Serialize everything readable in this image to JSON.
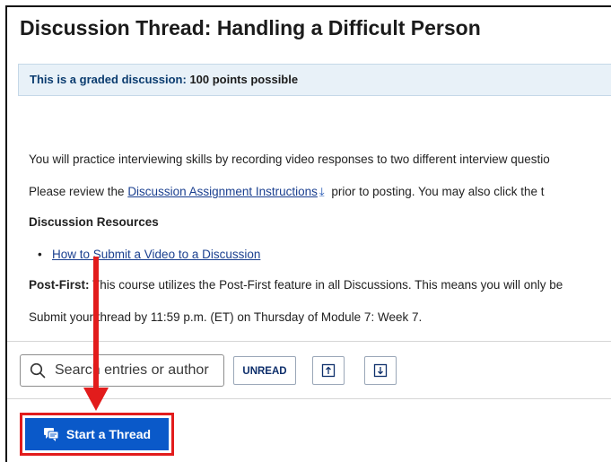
{
  "page": {
    "title": "Discussion Thread: Handling a Difficult Person"
  },
  "graded_banner": {
    "prefix": "This is a graded discussion:",
    "points": " 100 points possible"
  },
  "body": {
    "intro": "You will practice interviewing skills by recording video responses to two different interview questio",
    "review_prefix": "Please review the ",
    "instructions_link": "Discussion Assignment Instructions",
    "review_suffix": " prior to posting. You may also click the t",
    "resources_heading": "Discussion Resources",
    "resource_link": "How to Submit a Video to a Discussion",
    "post_first_label": "Post-First:",
    "post_first_text": "This course utilizes the Post-First feature in all Discussions. This means you will only be",
    "submit_text": "Submit your thread by 11:59 p.m. (ET) on Thursday of Module 7: Week 7."
  },
  "toolbar": {
    "search_placeholder": "Search entries or author",
    "unread_label": "UNREAD",
    "upload_icon": "arrow-up-box-icon",
    "download_icon": "arrow-down-box-icon"
  },
  "start_thread": {
    "label": "Start a Thread",
    "icon": "chat-bubble-icon"
  },
  "colors": {
    "accent_blue": "#0a59c9",
    "highlight_red": "#e21c1c",
    "banner_bg": "#e8f1f8"
  }
}
